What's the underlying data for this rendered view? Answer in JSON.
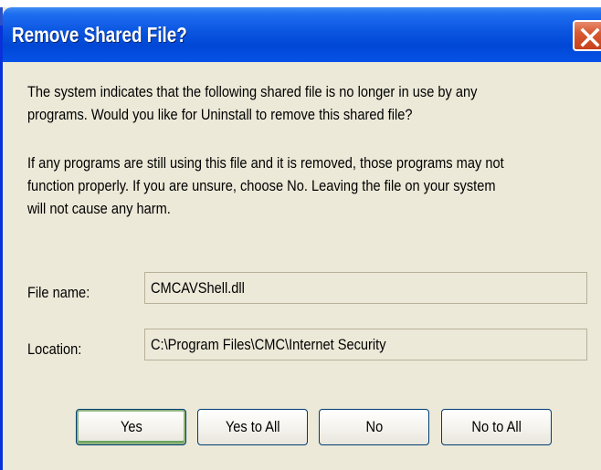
{
  "window": {
    "title": "Remove Shared File?"
  },
  "message": {
    "paragraph1": "The system indicates that the following shared file is no longer in use by any\nprograms. Would you like for Uninstall to remove this shared file?",
    "paragraph2": "If any programs are still using this file and it is removed, those programs may not\nfunction properly. If you are unsure, choose No. Leaving the file on your system\nwill not cause any harm."
  },
  "fields": {
    "file_name_label": "File name:",
    "file_name_value": "CMCAVShell.dll",
    "location_label": "Location:",
    "location_value": "C:\\Program Files\\CMC\\Internet Security"
  },
  "buttons": {
    "yes": "Yes",
    "yes_to_all": "Yes to All",
    "no": "No",
    "no_to_all": "No to All"
  },
  "icons": {
    "close": "close-icon"
  },
  "colors": {
    "titlebar": "#0a55e0",
    "dialog_bg": "#ece9d8",
    "close_button": "#d85a32",
    "default_button_highlight": "#8fb47e"
  }
}
